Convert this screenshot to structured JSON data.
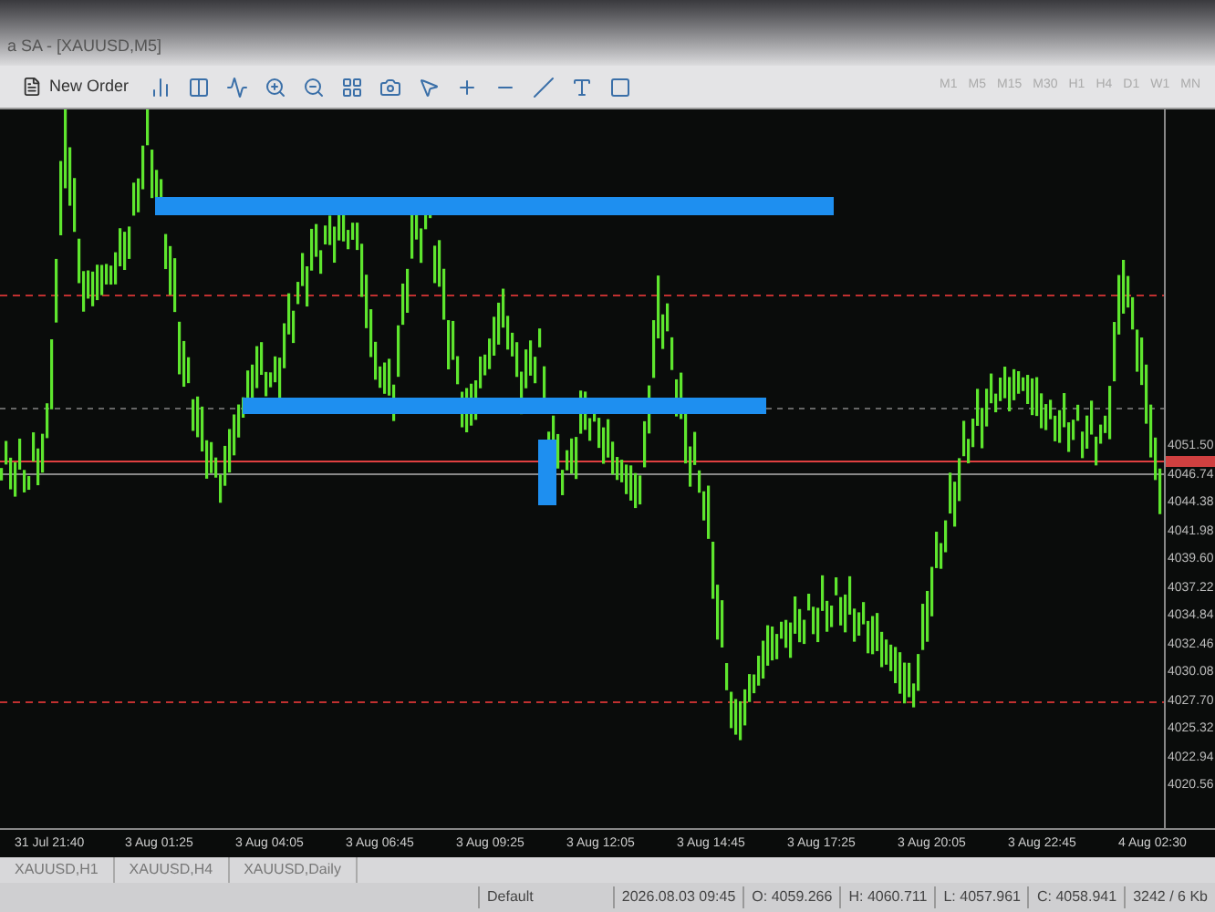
{
  "window": {
    "title": "a SA - [XAUUSD,M5]"
  },
  "toolbar": {
    "new_order": "New Order",
    "timeframes": [
      "M1",
      "M5",
      "M15",
      "M30",
      "H1",
      "H4",
      "D1",
      "W1",
      "MN"
    ]
  },
  "price_axis": [
    "4051.50",
    "4046.74",
    "4044.38",
    "4041.98",
    "4039.60",
    "4037.22",
    "4034.84",
    "4032.46",
    "4030.08",
    "4027.70",
    "4025.32",
    "4022.94",
    "4020.56"
  ],
  "time_axis": [
    "31 Jul 21:40",
    "3 Aug 01:25",
    "3 Aug 04:05",
    "3 Aug 06:45",
    "3 Aug 09:25",
    "3 Aug 12:05",
    "3 Aug 14:45",
    "3 Aug 17:25",
    "3 Aug 20:05",
    "3 Aug 22:45",
    "4 Aug 02:30"
  ],
  "tabs": [
    {
      "label": "XAUUSD,H1",
      "selected": false
    },
    {
      "label": "XAUUSD,H4",
      "selected": false
    },
    {
      "label": "XAUUSD,Daily",
      "selected": false
    }
  ],
  "status_bar": [
    "Default",
    "2026.08.03 09:45",
    "O: 4059.266",
    "H: 4060.711",
    "L: 4057.961",
    "C: 4058.941",
    "3242 / 6 Kb"
  ]
}
